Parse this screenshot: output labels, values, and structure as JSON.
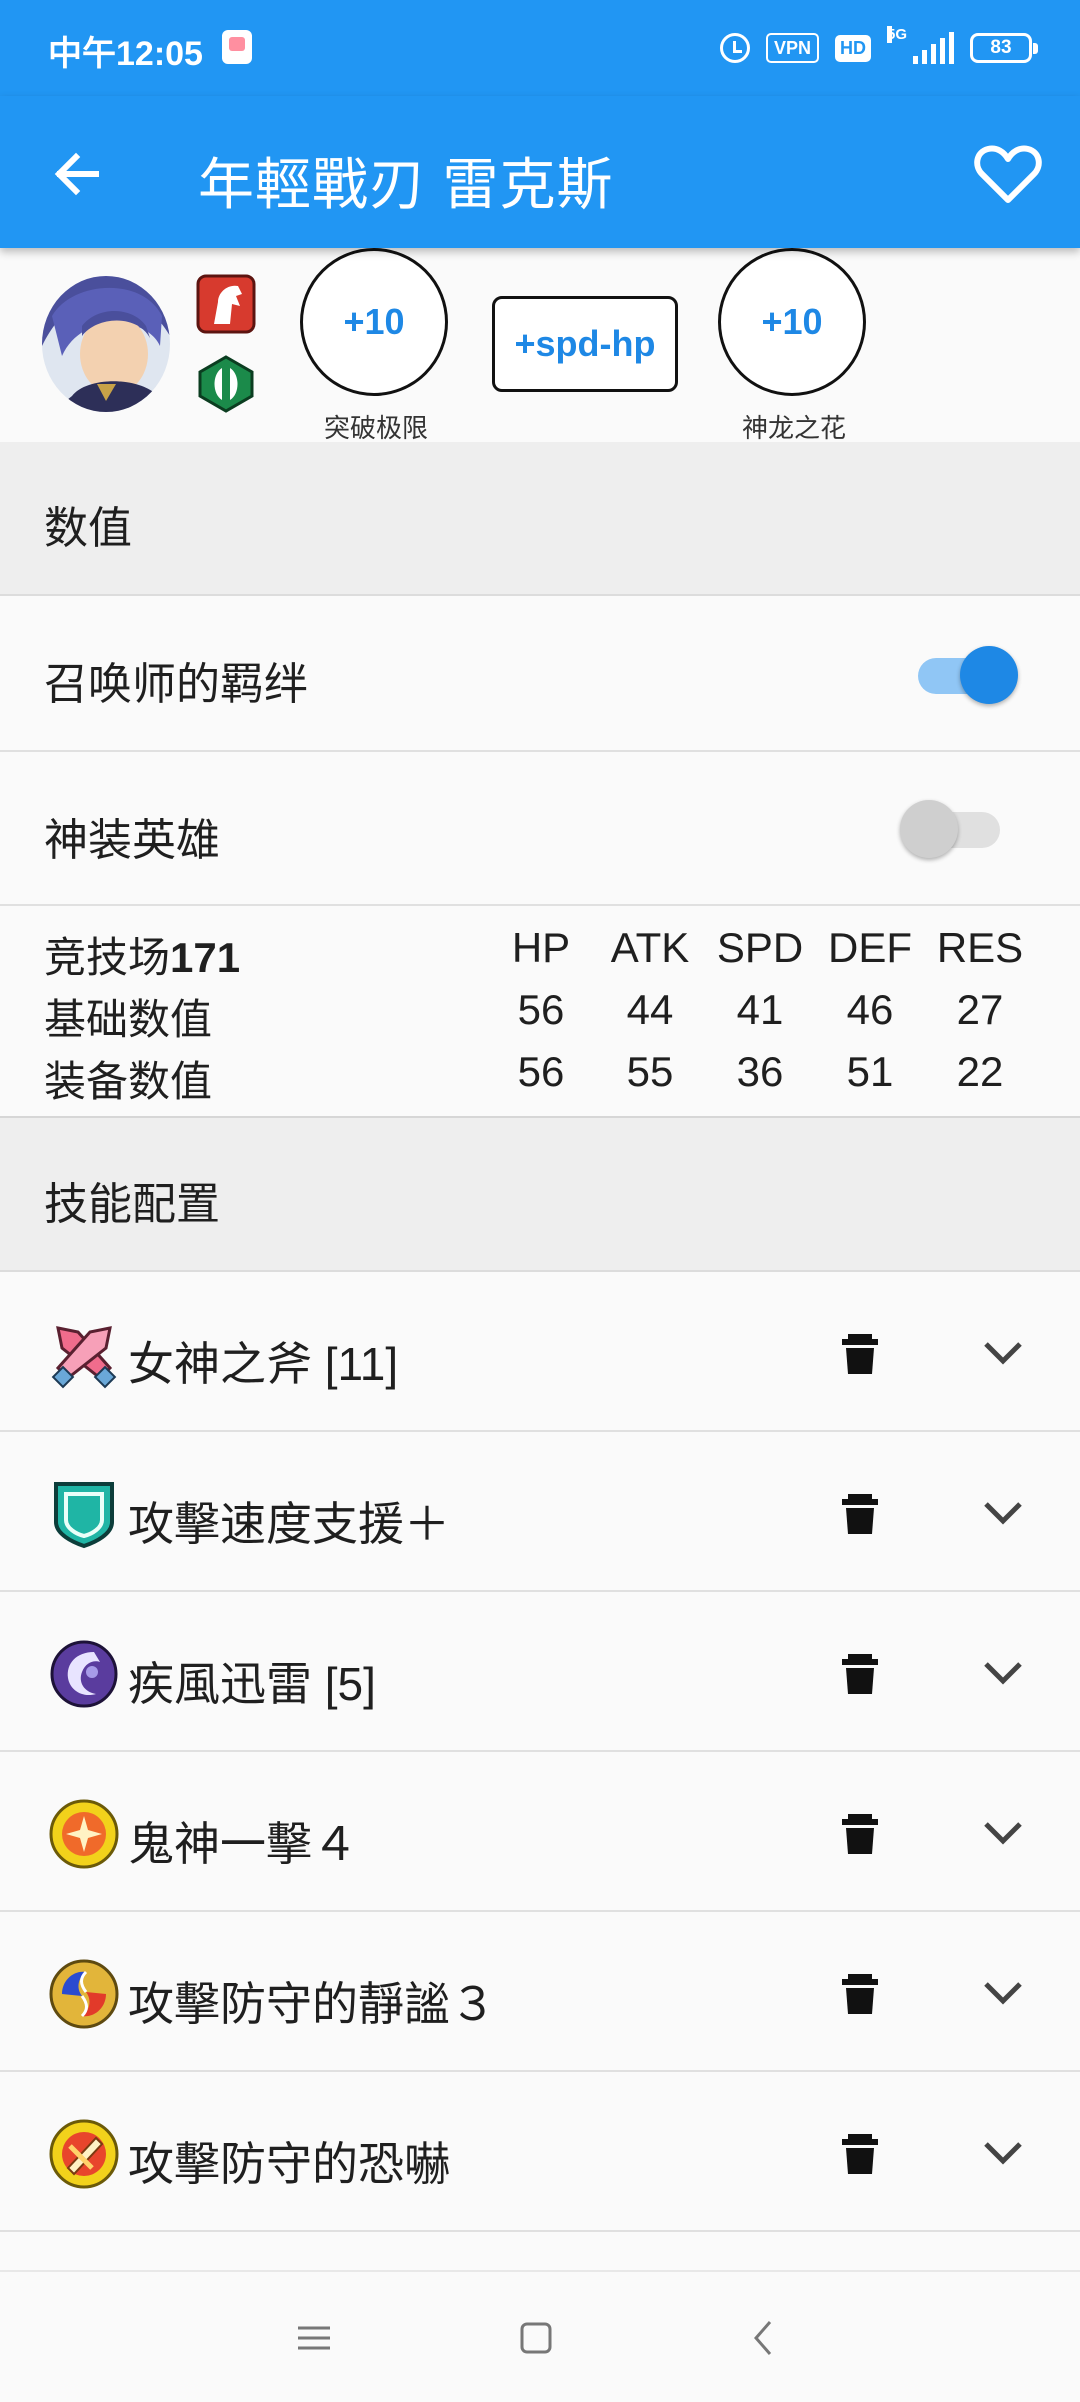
{
  "status_bar": {
    "time": "中午12:05",
    "vpn": "VPN",
    "hd": "HD",
    "network": "5G",
    "battery": "83"
  },
  "app_bar": {
    "title": "年輕戰刃 雷克斯"
  },
  "hero": {
    "merges_value": "+10",
    "merges_caption": "突破极限",
    "iv_value": "+spd-hp",
    "dragonflowers_value": "+10",
    "dragonflowers_caption": "神龙之花"
  },
  "stats_section": {
    "header": "数值",
    "summoner_support_label": "召唤师的羁绊",
    "summoner_support_on": true,
    "resplendent_label": "神装英雄",
    "resplendent_on": false
  },
  "stats_table": {
    "arena_label": "竞技场",
    "arena_score": "171",
    "columns": [
      "HP",
      "ATK",
      "SPD",
      "DEF",
      "RES"
    ],
    "rows": [
      {
        "label": "基础数值",
        "values": [
          "56",
          "44",
          "41",
          "46",
          "27"
        ]
      },
      {
        "label": "装备数值",
        "values": [
          "56",
          "55",
          "36",
          "51",
          "22"
        ]
      }
    ]
  },
  "skills_section": {
    "header": "技能配置",
    "skills": [
      {
        "name": "女神之斧 [11]",
        "icon": "weapon-icon"
      },
      {
        "name": "攻擊速度支援＋",
        "icon": "assist-icon"
      },
      {
        "name": "疾風迅雷 [5]",
        "icon": "special-icon"
      },
      {
        "name": "鬼神一擊４",
        "icon": "passive-a-icon"
      },
      {
        "name": "攻擊防守的靜謐３",
        "icon": "passive-b-icon"
      },
      {
        "name": "攻擊防守的恐嚇",
        "icon": "passive-c-icon"
      }
    ]
  },
  "colors": {
    "primary": "#2196f3",
    "accent": "#1e88e5",
    "section_bg": "#eeeeee"
  }
}
